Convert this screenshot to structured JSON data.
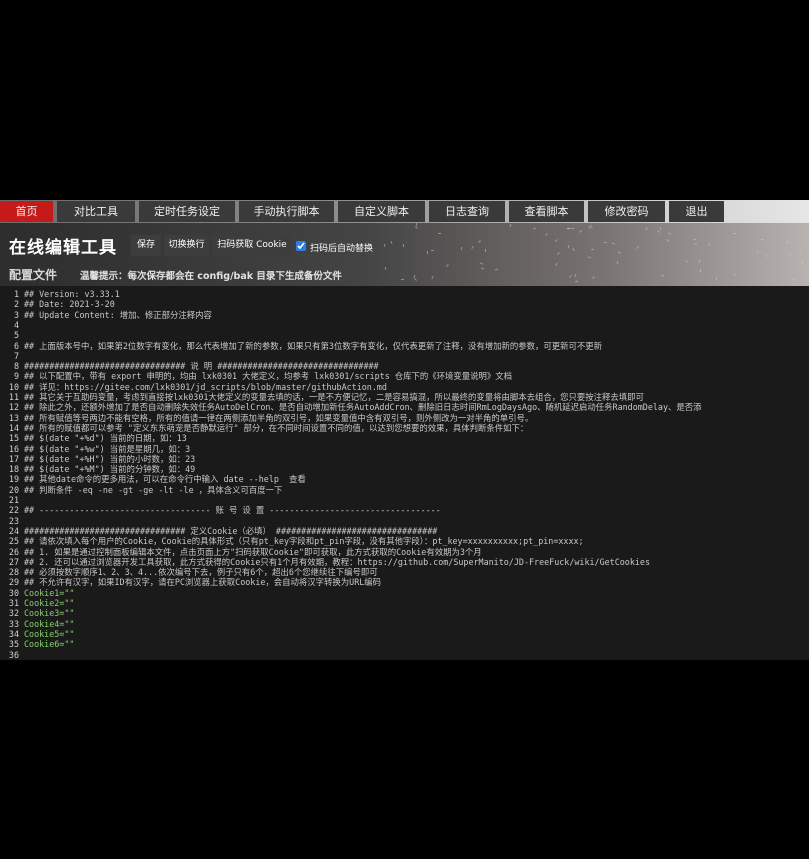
{
  "nav": {
    "items": [
      {
        "label": "首页",
        "active": true
      },
      {
        "label": "对比工具",
        "active": false
      },
      {
        "label": "定时任务设定",
        "active": false
      },
      {
        "label": "手动执行脚本",
        "active": false
      },
      {
        "label": "自定义脚本",
        "active": false
      },
      {
        "label": "日志查询",
        "active": false
      },
      {
        "label": "查看脚本",
        "active": false
      },
      {
        "label": "修改密码",
        "active": false
      },
      {
        "label": "退出",
        "active": false
      }
    ]
  },
  "header": {
    "title": "在线编辑工具",
    "subtitle": "配置文件",
    "hint": "温馨提示：每次保存都会在 config/bak 目录下生成备份文件",
    "buttons": {
      "save": "保存",
      "wrap": "切换换行",
      "scan": "扫码获取 Cookie"
    },
    "auto_replace": {
      "label": "扫码后自动替换",
      "checked": true
    }
  },
  "editor": {
    "lines": [
      {
        "n": "1",
        "text": "## Version: v3.33.1",
        "kind": "comment"
      },
      {
        "n": "2",
        "text": "## Date: 2021-3-20",
        "kind": "comment"
      },
      {
        "n": "3",
        "text": "## Update Content: 增加、修正部分注释内容",
        "kind": "comment"
      },
      {
        "n": "4",
        "text": "",
        "kind": "comment"
      },
      {
        "n": "5",
        "text": "",
        "kind": "comment"
      },
      {
        "n": "6",
        "text": "## 上面版本号中，如果第2位数字有变化，那么代表增加了新的参数，如果只有第3位数字有变化，仅代表更新了注释，没有增加新的参数，可更新可不更新",
        "kind": "comment"
      },
      {
        "n": "7",
        "text": "",
        "kind": "comment"
      },
      {
        "n": "8",
        "text": "################################ 说 明 ################################",
        "kind": "comment"
      },
      {
        "n": "9",
        "text": "## 以下配置中，带有 export 申明的，均由 lxk0301 大佬定义，均参考 lxk0301/scripts 仓库下的《环境变量说明》文档",
        "kind": "comment"
      },
      {
        "n": "10",
        "text": "## 详见：https://gitee.com/lxk0301/jd_scripts/blob/master/githubAction.md",
        "kind": "comment"
      },
      {
        "n": "11",
        "text": "## 其它关于互助码变量，考虑到直接按lxk0301大佬定义的变量去填的话，一是不方便记忆，二是容易搞混，所以最终的变量将由脚本去组合，您只要按注释去填即可",
        "kind": "comment"
      },
      {
        "n": "12",
        "text": "## 除此之外，还额外增加了是否自动删除失效任务AutoDelCron、是否自动增加新任务AutoAddCron、删除旧日志时间RmLogDaysAgo、随机延迟启动任务RandomDelay、是否添",
        "kind": "comment"
      },
      {
        "n": "13",
        "text": "## 所有赋值等号两边不能有空格，所有的值请一律在两侧添加半角的双引号，如果变量值中含有双引号，则外侧改为一对半角的单引号。",
        "kind": "comment"
      },
      {
        "n": "14",
        "text": "## 所有的赋值都可以参考 \"定义东东萌宠是否静默运行\" 部分，在不同时间设置不同的值，以达到您想要的效果，具体判断条件如下：",
        "kind": "comment"
      },
      {
        "n": "15",
        "text": "## $(date \"+%d\") 当前的日期，如：13",
        "kind": "comment"
      },
      {
        "n": "16",
        "text": "## $(date \"+%w\") 当前是星期几，如：3",
        "kind": "comment"
      },
      {
        "n": "17",
        "text": "## $(date \"+%H\") 当前的小时数，如：23",
        "kind": "comment"
      },
      {
        "n": "18",
        "text": "## $(date \"+%M\") 当前的分钟数，如：49",
        "kind": "comment"
      },
      {
        "n": "19",
        "text": "## 其他date命令的更多用法，可以在命令行中输入 date --help  查看",
        "kind": "comment"
      },
      {
        "n": "20",
        "text": "## 判断条件 -eq -ne -gt -ge -lt -le ，具体含义可百度一下",
        "kind": "comment"
      },
      {
        "n": "21",
        "text": "",
        "kind": "comment"
      },
      {
        "n": "22",
        "text": "## ---------------------------------- 账 号 设 置 ----------------------------------",
        "kind": "comment"
      },
      {
        "n": "23",
        "text": "",
        "kind": "comment"
      },
      {
        "n": "24",
        "text": "################################ 定义Cookie（必填） ################################",
        "kind": "comment"
      },
      {
        "n": "25",
        "text": "## 请依次填入每个用户的Cookie，Cookie的具体形式（只有pt_key字段和pt_pin字段，没有其他字段）：pt_key=xxxxxxxxxx;pt_pin=xxxx;",
        "kind": "comment"
      },
      {
        "n": "26",
        "text": "## 1. 如果是通过控制面板编辑本文件，点击页面上方\"扫码获取Cookie\"即可获取，此方式获取的Cookie有效期为3个月",
        "kind": "comment"
      },
      {
        "n": "27",
        "text": "## 2. 还可以通过浏览器开发工具获取，此方式获得的Cookie只有1个月有效期，教程：https://github.com/SuperManito/JD-FreeFuck/wiki/GetCookies",
        "kind": "comment"
      },
      {
        "n": "28",
        "text": "## 必须按数字顺序1、2、3、4...依次编号下去，例子只有6个，超出6个您继续往下编号即可",
        "kind": "comment"
      },
      {
        "n": "29",
        "text": "## 不允许有汉字，如果ID有汉字，请在PC浏览器上获取Cookie，会自动将汉字转换为URL编码",
        "kind": "comment"
      },
      {
        "n": "30",
        "text": "Cookie1=\"\"",
        "kind": "assign"
      },
      {
        "n": "31",
        "text": "Cookie2=\"\"",
        "kind": "assign"
      },
      {
        "n": "32",
        "text": "Cookie3=\"\"",
        "kind": "assign"
      },
      {
        "n": "33",
        "text": "Cookie4=\"\"",
        "kind": "assign"
      },
      {
        "n": "34",
        "text": "Cookie5=\"\"",
        "kind": "assign"
      },
      {
        "n": "35",
        "text": "Cookie6=\"\"",
        "kind": "assign"
      },
      {
        "n": "36",
        "text": "",
        "kind": "comment"
      }
    ]
  }
}
